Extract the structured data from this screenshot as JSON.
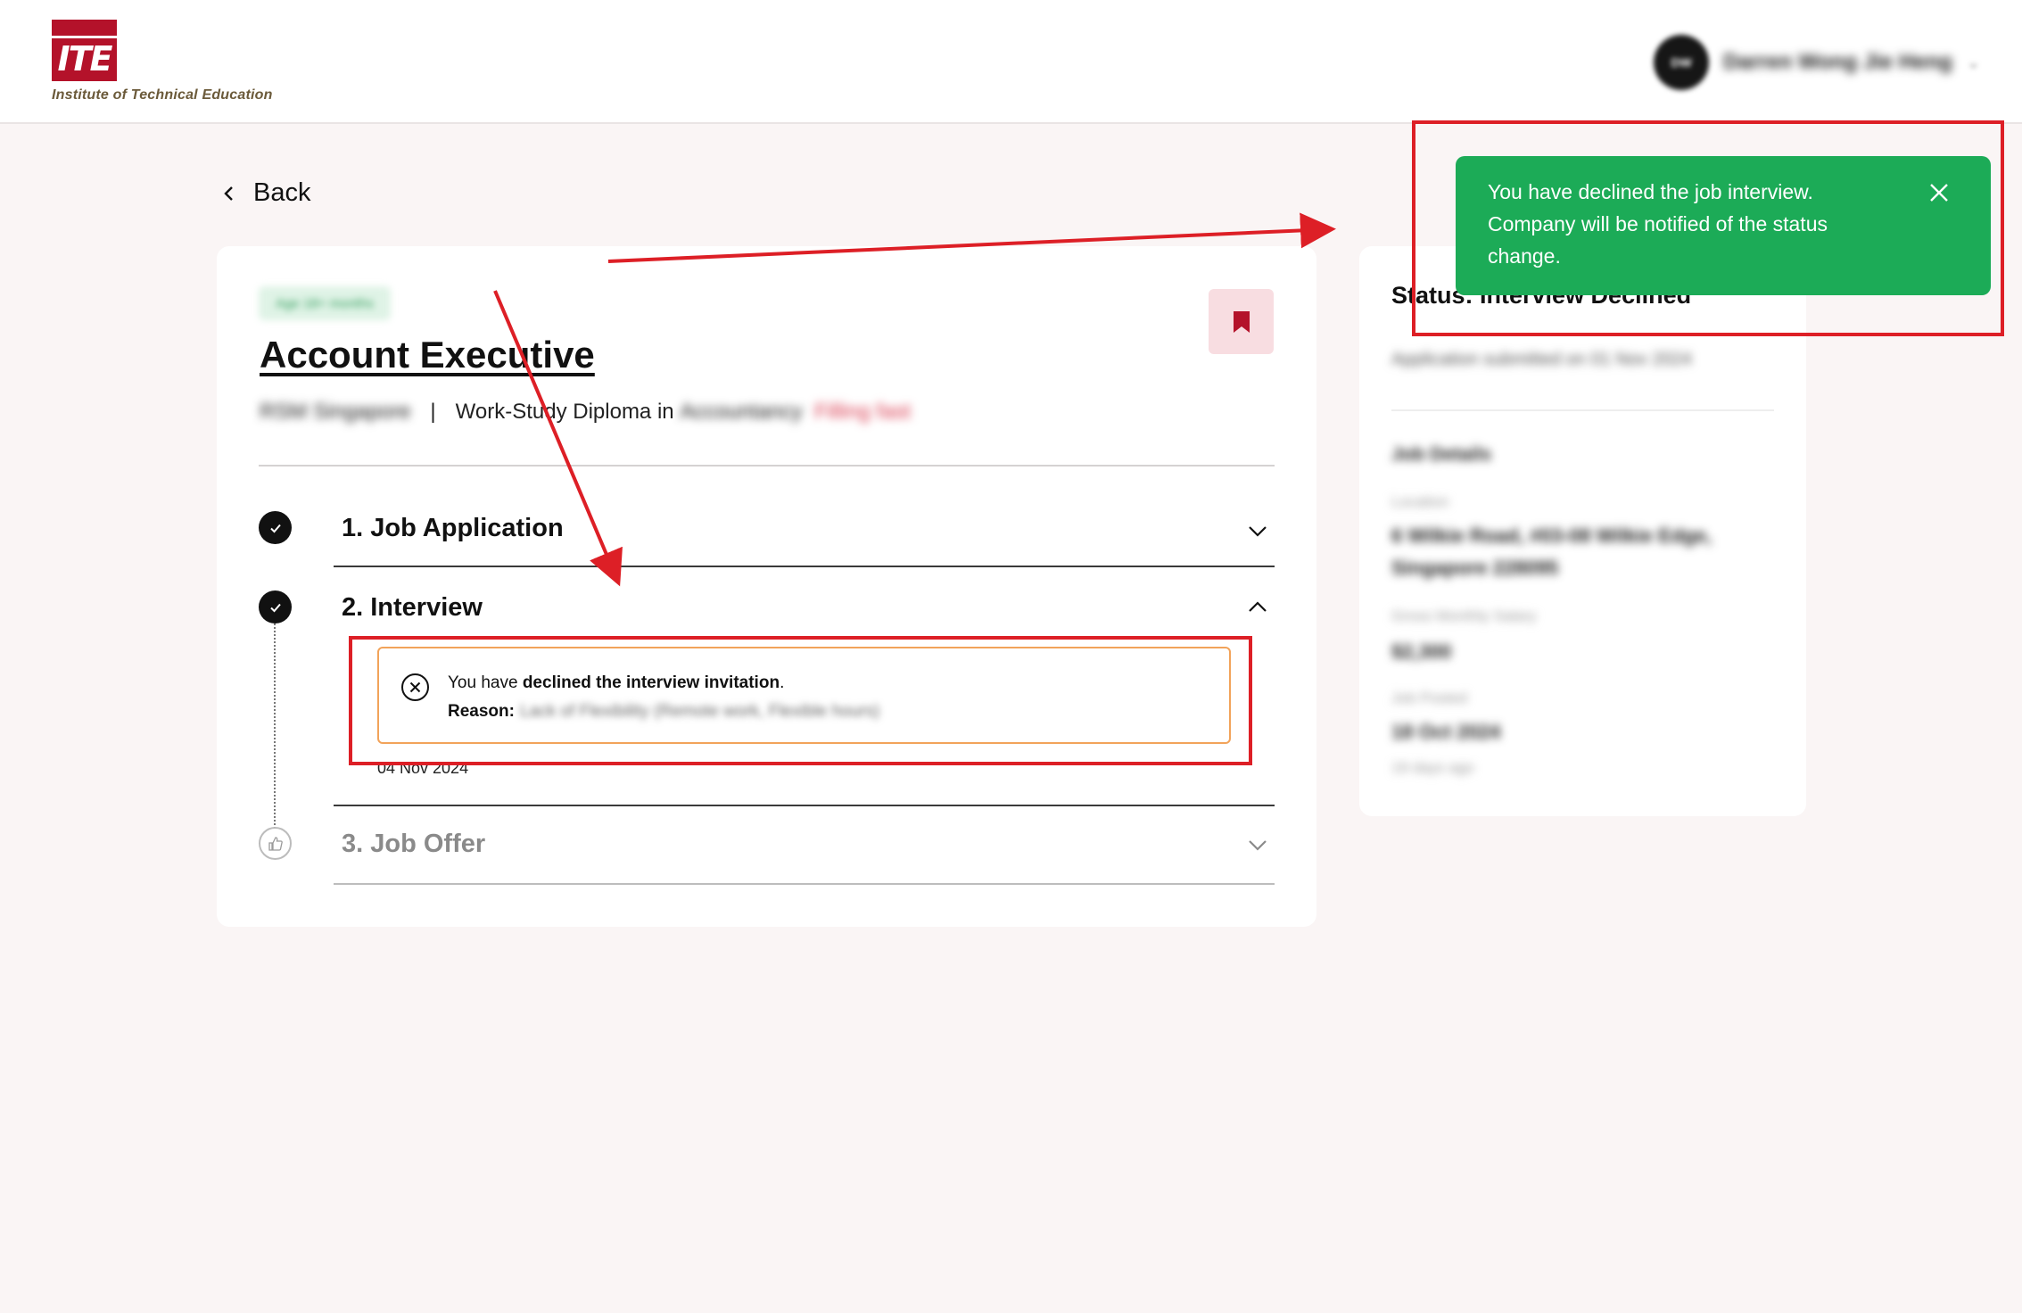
{
  "header": {
    "logo_mark": "ITE",
    "logo_text": "Institute of Technical Education",
    "user_initials": "DW",
    "user_name": "Darren Wong Jie Heng"
  },
  "nav": {
    "back_label": "Back"
  },
  "job": {
    "tag": "Age 18+ months",
    "title": "Account Executive",
    "company": "RSM Singapore",
    "separator": "|",
    "programme_prefix": "Work-Study Diploma in",
    "programme": "Accountancy",
    "status_hint": "Filling fast"
  },
  "steps": [
    {
      "label": "1. Job Application",
      "state": "completed"
    },
    {
      "label": "2. Interview",
      "state": "completed"
    },
    {
      "label": "3. Job Offer",
      "state": "pending"
    }
  ],
  "interview_notice": {
    "prefix": "You have ",
    "emphasis": "declined the interview invitation",
    "suffix": ".",
    "reason_label": "Reason:",
    "reason_value": "Lack of Flexibility (Remote work, Flexible hours)",
    "date": "04 Nov 2024"
  },
  "side": {
    "status_title": "Status: Interview Declined",
    "submitted": "Application submitted on 01 Nov 2024",
    "job_details_heading": "Job Details",
    "location_label": "Location",
    "location_line1": "6 Wilkie Road, #03-08 Wilkie Edge,",
    "location_line2": "Singapore 228095",
    "salary_label": "Gross Monthly Salary",
    "salary_value": "$2,300",
    "posted_label": "Job Posted",
    "posted_value": "18 Oct 2024",
    "posted_ago": "19 days ago"
  },
  "toast": {
    "message": "You have declined the job interview. Company will be notified of the status change."
  },
  "colors": {
    "brand_red": "#b4122a",
    "toast_green": "#1cab57",
    "warning_border": "#f2a35a",
    "annotation_red": "#dd1f26"
  }
}
